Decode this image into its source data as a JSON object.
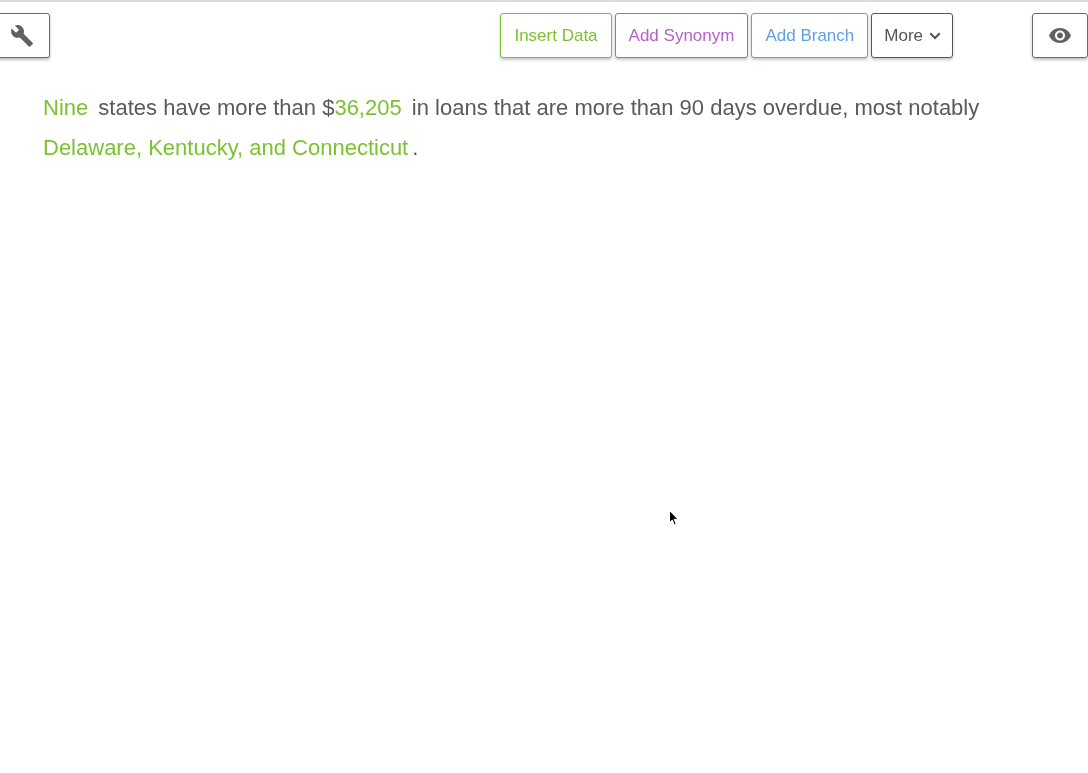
{
  "actions": [
    {
      "label": "Insert Data",
      "kind": "button",
      "color": "#7cc230"
    },
    {
      "label": "Add Synonym",
      "kind": "button",
      "color": "#b660c8"
    },
    {
      "label": "Add Branch",
      "kind": "button",
      "color": "#5ea0e8"
    },
    {
      "label": "More",
      "kind": "menu",
      "color": "#555555"
    }
  ],
  "narrative": {
    "segments": [
      {
        "kind": "data",
        "text": "Nine"
      },
      {
        "kind": "text",
        "text": " states have more than $"
      },
      {
        "kind": "data",
        "text": "36,205"
      },
      {
        "kind": "text",
        "text": " in loans that are more than 90 days overdue, most notably "
      },
      {
        "kind": "data",
        "text": "Delaware, Kentucky, and Connecticut"
      },
      {
        "kind": "text",
        "text": "."
      }
    ]
  }
}
